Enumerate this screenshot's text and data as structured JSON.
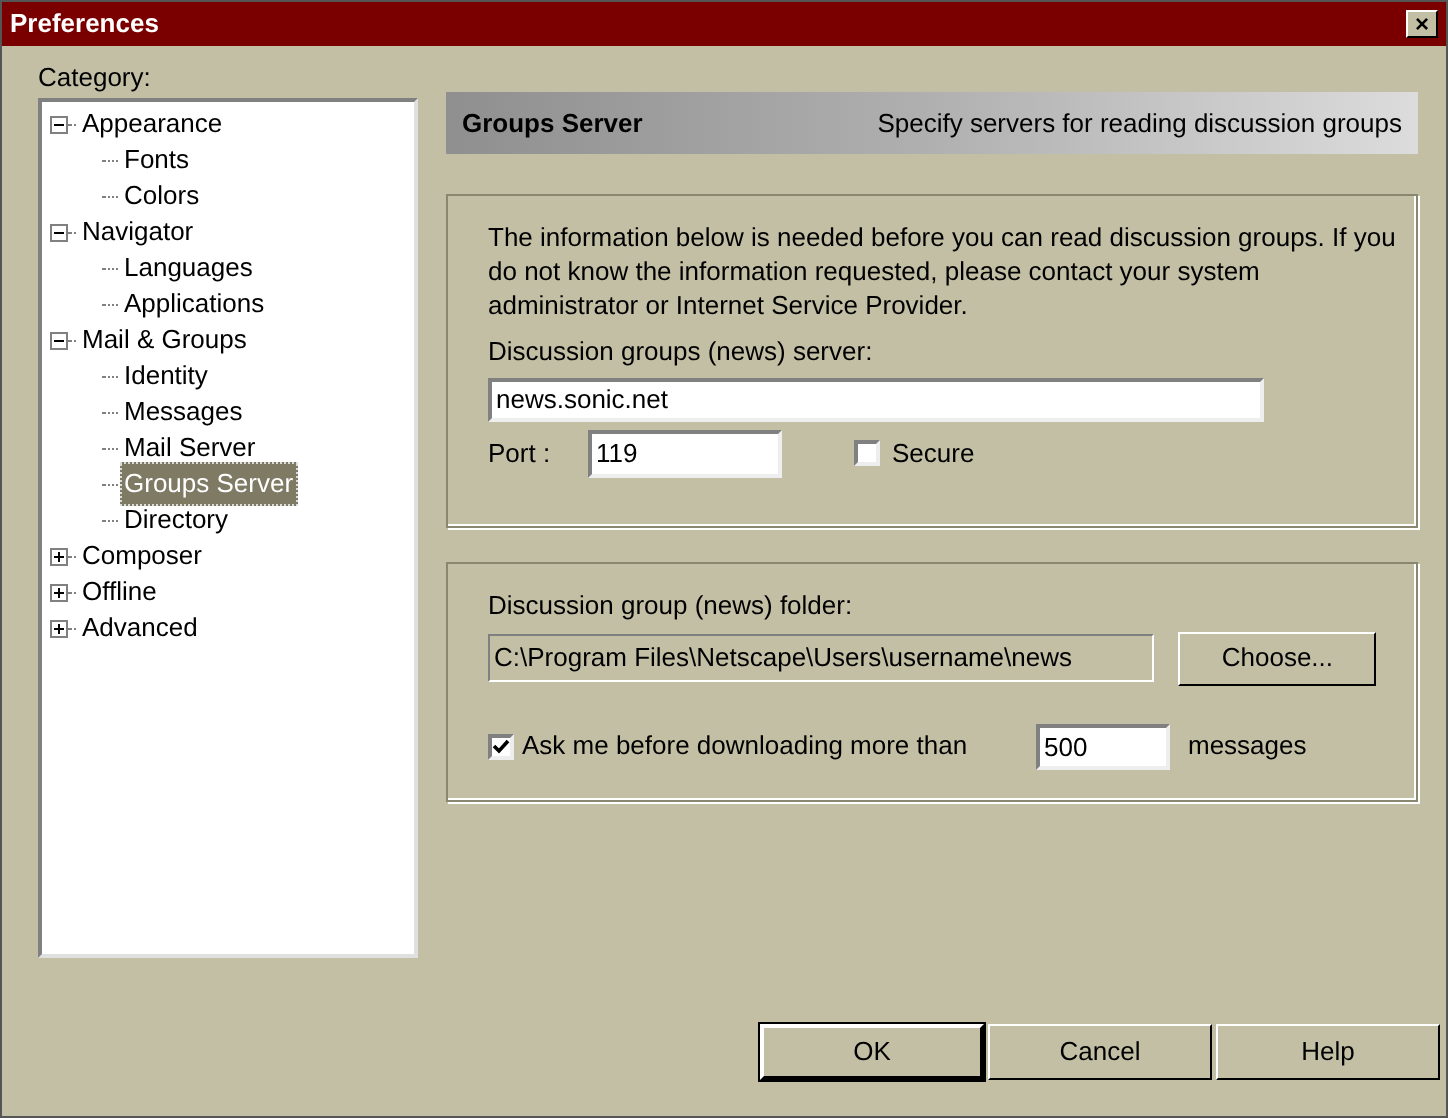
{
  "window": {
    "title": "Preferences",
    "close": "×"
  },
  "category_label": "Category:",
  "tree": [
    {
      "label": "Appearance",
      "expanded": true,
      "selected": false,
      "children": [
        {
          "label": "Fonts",
          "selected": false
        },
        {
          "label": "Colors",
          "selected": false
        }
      ]
    },
    {
      "label": "Navigator",
      "expanded": true,
      "selected": false,
      "children": [
        {
          "label": "Languages",
          "selected": false
        },
        {
          "label": "Applications",
          "selected": false
        }
      ]
    },
    {
      "label": "Mail & Groups",
      "expanded": true,
      "selected": false,
      "children": [
        {
          "label": "Identity",
          "selected": false
        },
        {
          "label": "Messages",
          "selected": false
        },
        {
          "label": "Mail Server",
          "selected": false
        },
        {
          "label": "Groups Server",
          "selected": true
        },
        {
          "label": "Directory",
          "selected": false
        }
      ]
    },
    {
      "label": "Composer",
      "expanded": false,
      "selected": false
    },
    {
      "label": "Offline",
      "expanded": false,
      "selected": false
    },
    {
      "label": "Advanced",
      "expanded": false,
      "selected": false
    }
  ],
  "header": {
    "title": "Groups Server",
    "description": "Specify servers for reading discussion groups"
  },
  "server_group": {
    "info": "The information below is needed before you can read discussion groups.  If you do not know the information requested, please contact your system administrator or Internet Service Provider.",
    "server_label": "Discussion groups (news) server:",
    "server_value": "news.sonic.net",
    "port_label": "Port :",
    "port_value": "119",
    "secure": {
      "label": "Secure",
      "checked": false
    }
  },
  "folder_group": {
    "folder_label": "Discussion group (news) folder:",
    "folder_value": "C:\\Program Files\\Netscape\\Users\\username\\news",
    "choose_button": "Choose...",
    "ask": {
      "label": "Ask me before downloading more than",
      "checked": true
    },
    "limit_value": "500",
    "limit_unit": "messages"
  },
  "buttons": [
    "OK",
    "Cancel",
    "Help"
  ]
}
